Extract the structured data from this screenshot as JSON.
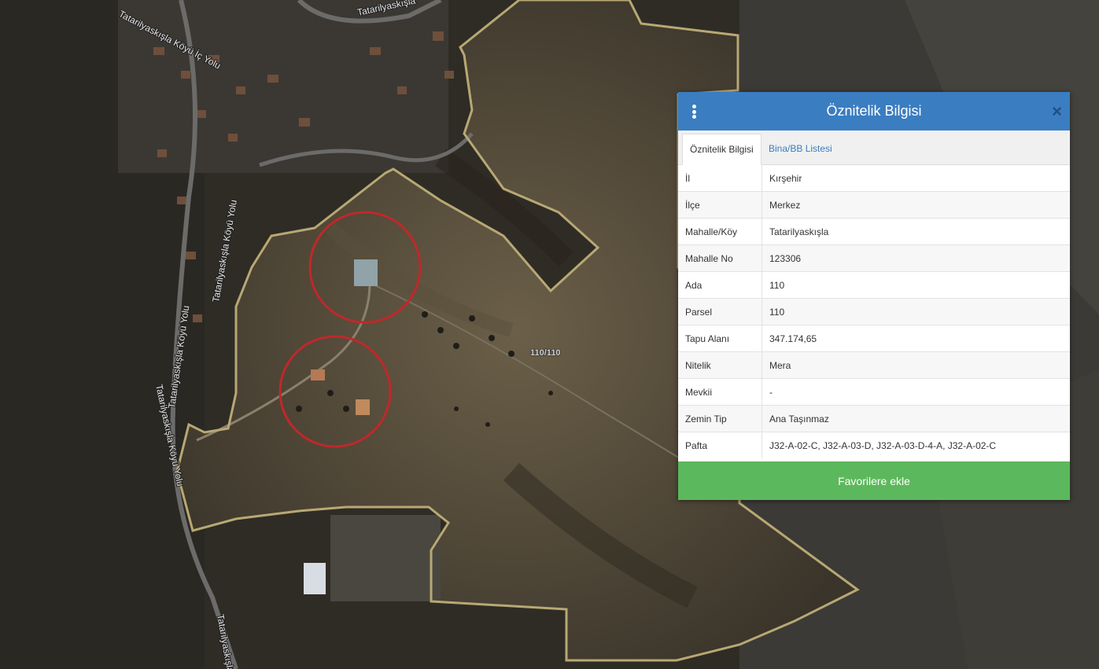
{
  "map": {
    "road_labels": [
      "Tatarilyaskışla Köyü İç Yolu",
      "Tatarilyaskışla",
      "Tatarilyaskışla Köyü Yolu",
      "Tatarilyaskışla Köyü Yolu",
      "Tatarilyaskışla Köyü Yolu",
      "Tatarilyaskışla"
    ],
    "parcel_label": "110/110"
  },
  "panel": {
    "title": "Öznitelik Bilgisi",
    "menu_icon": "vertical-dots-icon",
    "close_icon": "close-icon",
    "close_glyph": "×",
    "tabs": [
      {
        "label": "Öznitelik Bilgisi",
        "active": true
      },
      {
        "label": "Bina/BB Listesi",
        "active": false
      }
    ],
    "rows": [
      {
        "key": "İl",
        "value": "Kırşehir"
      },
      {
        "key": "İlçe",
        "value": "Merkez"
      },
      {
        "key": "Mahalle/Köy",
        "value": "Tatarilyaskışla"
      },
      {
        "key": "Mahalle No",
        "value": "123306"
      },
      {
        "key": "Ada",
        "value": "110"
      },
      {
        "key": "Parsel",
        "value": "110"
      },
      {
        "key": "Tapu Alanı",
        "value": "347.174,65"
      },
      {
        "key": "Nitelik",
        "value": "Mera"
      },
      {
        "key": "Mevkii",
        "value": "-"
      },
      {
        "key": "Zemin Tip",
        "value": "Ana Taşınmaz"
      },
      {
        "key": "Pafta",
        "value": "J32-A-02-C, J32-A-03-D, J32-A-03-D-4-A, J32-A-02-C"
      }
    ],
    "favorite_button": "Favorilere ekle"
  },
  "colors": {
    "header": "#3a7dc1",
    "button": "#5cb85c",
    "parcel_border": "#b8a874",
    "highlight_circle": "#c0282a"
  }
}
